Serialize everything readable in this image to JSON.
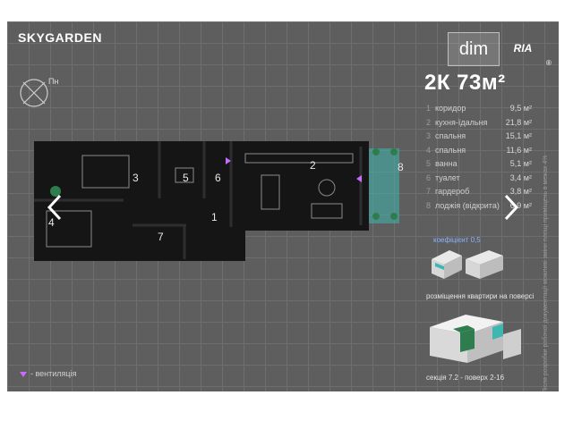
{
  "brand": "SKYGARDEN",
  "compass_label": "Пн",
  "watermark": {
    "dim": "dim",
    "ria": "RIA",
    "reg": "®"
  },
  "apartment_title": "2К 73м²",
  "rooms": [
    {
      "num": "1",
      "name": "коридор",
      "area": "9,5 м²"
    },
    {
      "num": "2",
      "name": "кухня-їдальня",
      "area": "21,8 м²"
    },
    {
      "num": "3",
      "name": "спальня",
      "area": "15,1 м²"
    },
    {
      "num": "4",
      "name": "спальня",
      "area": "11,6 м²"
    },
    {
      "num": "5",
      "name": "ванна",
      "area": "5,1 м²"
    },
    {
      "num": "6",
      "name": "туалет",
      "area": "3,4 м²"
    },
    {
      "num": "7",
      "name": "гардероб",
      "area": "3,8 м²"
    },
    {
      "num": "8",
      "name": "лоджія (відкрита)",
      "area": "6,9 м²"
    }
  ],
  "coefficient": "коефіцієнт 0,5",
  "plan_labels": [
    "1",
    "2",
    "3",
    "4",
    "5",
    "6",
    "7",
    "8"
  ],
  "vent_legend": "- вентиляція",
  "placement_caption": "розміщення квартири на поверсі",
  "section_caption": "секція 7.2 - поверх 2-16",
  "side_note": "Після розробки робочої документації можливі зміни площі приміщень в межах 4%",
  "nav": {
    "prev_icon": "chevron-left-icon",
    "next_icon": "chevron-right-icon"
  },
  "colors": {
    "background": "#5e5e5e",
    "accent_teal": "#3fb7b0",
    "accent_green": "#2f7d4f",
    "vent": "#c96bff",
    "coef": "#8ab4ff"
  }
}
